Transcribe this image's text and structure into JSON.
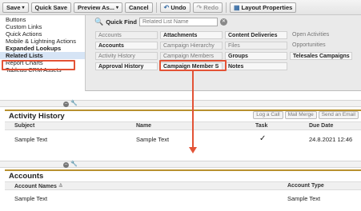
{
  "toolbar": {
    "save": "Save",
    "quick_save": "Quick Save",
    "preview_as": "Preview As...",
    "cancel": "Cancel",
    "undo": "Undo",
    "redo": "Redo",
    "layout_properties": "Layout Properties"
  },
  "leftnav": {
    "items": [
      {
        "label": "Buttons"
      },
      {
        "label": "Custom Links"
      },
      {
        "label": "Quick Actions"
      },
      {
        "label": "Mobile & Lightning Actions"
      },
      {
        "label": "Expanded Lookups"
      },
      {
        "label": "Related Lists"
      },
      {
        "label": "Report Charts"
      },
      {
        "label": "Tableau CRM Assets"
      }
    ]
  },
  "quick_find": {
    "label": "Quick Find",
    "placeholder": "Related List Name"
  },
  "palette": {
    "rows": [
      [
        "Accounts",
        "Attachments",
        "Content Deliveries",
        "Open Activities"
      ],
      [
        "Accounts",
        "Campaign Hierarchy",
        "Files",
        "Opportunities"
      ],
      [
        "Activity History",
        "Campaign Members",
        "Groups",
        "Telesales Campaigns"
      ],
      [
        "Approval History",
        "Campaign Member S",
        "Notes",
        ""
      ]
    ]
  },
  "activity_history": {
    "title": "Activity History",
    "buttons": [
      "Log a Call",
      "Mail Merge",
      "Send an Email"
    ],
    "columns": [
      "Subject",
      "Name",
      "Task",
      "Due Date"
    ],
    "row": {
      "subject": "Sample Text",
      "name": "Sample Text",
      "task": "✓",
      "due_date": "24.8.2021 12:46"
    }
  },
  "accounts": {
    "title": "Accounts",
    "columns": [
      "Account Names",
      "Account Type"
    ],
    "row": {
      "name": "Sample Text",
      "type": "Sample Text"
    }
  },
  "colors": {
    "highlight": "#e35336",
    "section_accent": "#b8912f"
  }
}
